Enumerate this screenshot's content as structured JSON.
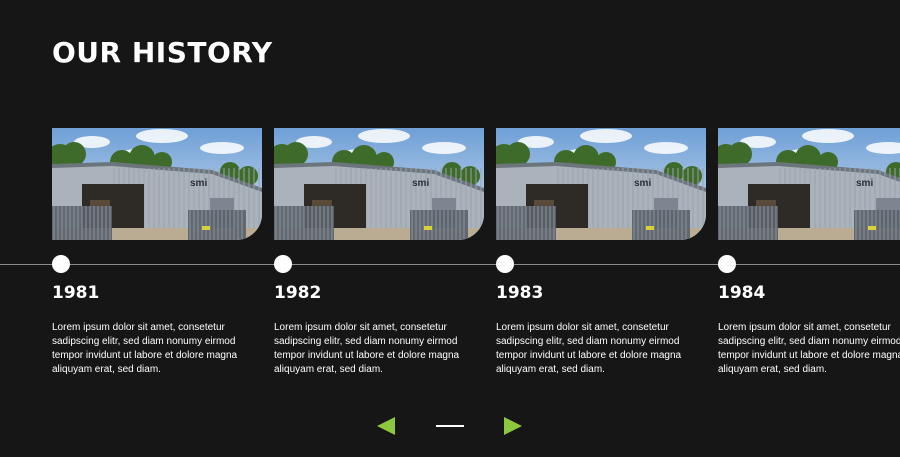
{
  "title": "OUR HISTORY",
  "colors": {
    "background": "#161616",
    "accent": "#8dc63f",
    "text": "#ffffff",
    "timeline_line": "#8a8a8a"
  },
  "timeline": {
    "items": [
      {
        "year": "1981",
        "image": "warehouse-photo",
        "image_sign": "smi",
        "text": "Lorem ipsum dolor sit amet, consetetur sadipscing elitr, sed diam nonumy eirmod tempor invidunt ut labore et dolore magna aliquyam erat, sed diam."
      },
      {
        "year": "1982",
        "image": "warehouse-photo",
        "image_sign": "smi",
        "text": "Lorem ipsum dolor sit amet, consetetur sadipscing elitr, sed diam nonumy eirmod tempor invidunt ut labore et dolore magna aliquyam erat, sed diam."
      },
      {
        "year": "1983",
        "image": "warehouse-photo",
        "image_sign": "smi",
        "text": "Lorem ipsum dolor sit amet, consetetur sadipscing elitr, sed diam nonumy eirmod tempor invidunt ut labore et dolore magna aliquyam erat, sed diam."
      },
      {
        "year": "1984",
        "image": "warehouse-photo",
        "image_sign": "smi",
        "text": "Lorem ipsum dolor sit amet, consetetur sadipscing elitr, sed diam nonumy eirmod tempor invidunt ut labore et dolore magna aliquyam erat, sed diam."
      }
    ]
  },
  "navigation": {
    "prev_icon": "triangle-left-icon",
    "next_icon": "triangle-right-icon",
    "progress": 1.0
  }
}
